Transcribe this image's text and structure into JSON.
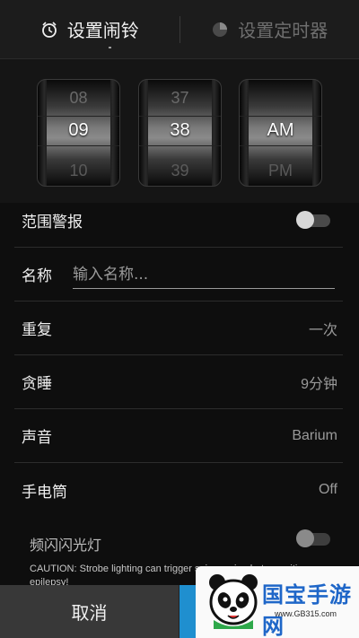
{
  "tabs": [
    {
      "label": "设置闹铃",
      "icon": "alarm-clock-icon",
      "active": true
    },
    {
      "label": "设置定时器",
      "icon": "timer-pie-icon",
      "active": false
    }
  ],
  "time_picker": {
    "hour": {
      "prev": "08",
      "current": "09",
      "next": "10"
    },
    "minute": {
      "prev": "37",
      "current": "38",
      "next": "39"
    },
    "ampm": {
      "prev": "",
      "current": "AM",
      "next": "PM"
    }
  },
  "settings": {
    "range_alert": {
      "label": "范围警报",
      "enabled": false
    },
    "name": {
      "label": "名称",
      "value": "",
      "placeholder": "输入名称..."
    },
    "repeat": {
      "label": "重复",
      "value": "一次"
    },
    "snooze": {
      "label": "贪睡",
      "value": "9分钟"
    },
    "sound": {
      "label": "声音",
      "value": "Barium"
    },
    "flashlight": {
      "label": "手电筒",
      "value": "Off"
    },
    "strobe": {
      "label": "频闪闪光灯",
      "enabled": false
    },
    "caution": "CAUTION: Strobe lighting can trigger seizures in photosensitive epilepsy!"
  },
  "actions": {
    "cancel_label": "取消"
  },
  "watermark": {
    "text": "国宝手游网",
    "url": "www.GB315.com"
  },
  "colors": {
    "accent": "#1f8fcf",
    "background": "#0e0e0e"
  }
}
